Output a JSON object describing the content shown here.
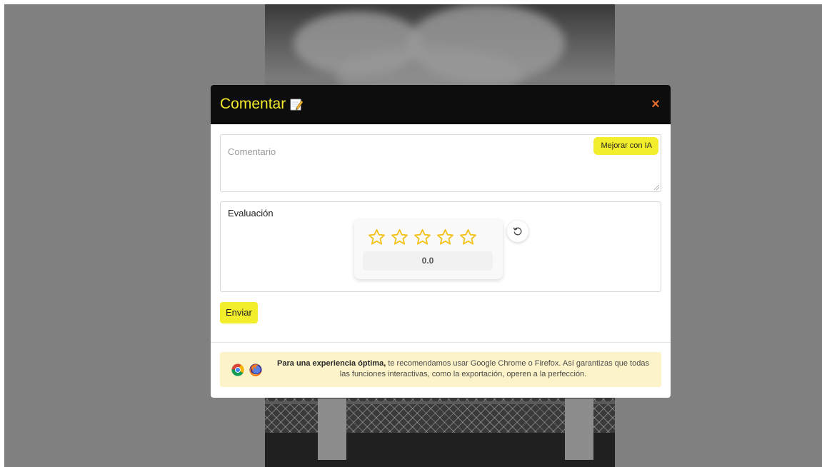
{
  "modal": {
    "title": "Comentar",
    "title_icon": "memo-icon",
    "close_glyph": "×"
  },
  "comment": {
    "placeholder": "Comentario",
    "value": "",
    "ai_button_label": "Mejorar con IA"
  },
  "evaluation": {
    "label": "Evaluación",
    "stars_total": 5,
    "rating": 0,
    "score_text": "0.0",
    "star_icon": "star-outline-icon",
    "reset_icon": "reset-icon"
  },
  "actions": {
    "submit_label": "Enviar"
  },
  "notice": {
    "bold_text": "Para una experiencia óptima,",
    "rest_text": " te recomendamos usar Google Chrome o Firefox. Así garantizas que todas las funciones interactivas, como la exportación, operen a la perfección.",
    "icons": [
      "chrome-icon",
      "firefox-icon"
    ]
  },
  "colors": {
    "accent": "#f3ee2c",
    "header_bg": "#0d0d0d",
    "title_color": "#f2ea2a",
    "close_color": "#e06a2a",
    "star_color": "#f2c21a",
    "notice_bg": "#fdf3c9"
  }
}
